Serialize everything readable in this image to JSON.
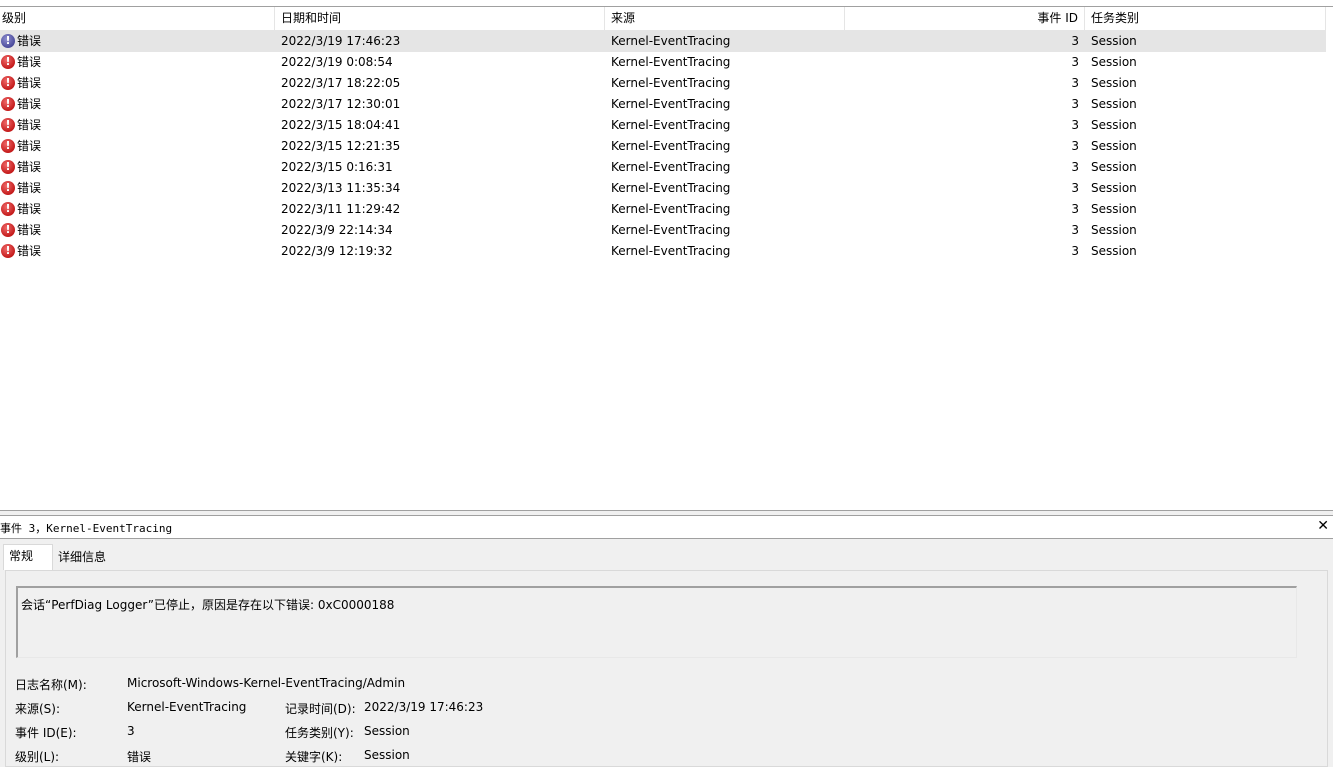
{
  "columns": {
    "level": "级别",
    "datetime": "日期和时间",
    "source": "来源",
    "event_id": "事件 ID",
    "task": "任务类别"
  },
  "events": [
    {
      "level": "错误",
      "datetime": "2022/3/19 17:46:23",
      "source": "Kernel-EventTracing",
      "event_id": "3",
      "task": "Session"
    },
    {
      "level": "错误",
      "datetime": "2022/3/19 0:08:54",
      "source": "Kernel-EventTracing",
      "event_id": "3",
      "task": "Session"
    },
    {
      "level": "错误",
      "datetime": "2022/3/17 18:22:05",
      "source": "Kernel-EventTracing",
      "event_id": "3",
      "task": "Session"
    },
    {
      "level": "错误",
      "datetime": "2022/3/17 12:30:01",
      "source": "Kernel-EventTracing",
      "event_id": "3",
      "task": "Session"
    },
    {
      "level": "错误",
      "datetime": "2022/3/15 18:04:41",
      "source": "Kernel-EventTracing",
      "event_id": "3",
      "task": "Session"
    },
    {
      "level": "错误",
      "datetime": "2022/3/15 12:21:35",
      "source": "Kernel-EventTracing",
      "event_id": "3",
      "task": "Session"
    },
    {
      "level": "错误",
      "datetime": "2022/3/15 0:16:31",
      "source": "Kernel-EventTracing",
      "event_id": "3",
      "task": "Session"
    },
    {
      "level": "错误",
      "datetime": "2022/3/13 11:35:34",
      "source": "Kernel-EventTracing",
      "event_id": "3",
      "task": "Session"
    },
    {
      "level": "错误",
      "datetime": "2022/3/11 11:29:42",
      "source": "Kernel-EventTracing",
      "event_id": "3",
      "task": "Session"
    },
    {
      "level": "错误",
      "datetime": "2022/3/9 22:14:34",
      "source": "Kernel-EventTracing",
      "event_id": "3",
      "task": "Session"
    },
    {
      "level": "错误",
      "datetime": "2022/3/9 12:19:32",
      "source": "Kernel-EventTracing",
      "event_id": "3",
      "task": "Session"
    }
  ],
  "detail": {
    "title": "事件 3，Kernel-EventTracing",
    "close_glyph": "✕",
    "tabs": [
      "常规",
      "详细信息"
    ],
    "message": "会话“PerfDiag Logger”已停止，原因是存在以下错误: 0xC0000188",
    "log_name_label": "日志名称(M):",
    "log_name_value": "Microsoft-Windows-Kernel-EventTracing/Admin",
    "source_label": "来源(S):",
    "source_value": "Kernel-EventTracing",
    "logged_label": "记录时间(D):",
    "logged_value": "2022/3/19 17:46:23",
    "event_id_label": "事件 ID(E):",
    "event_id_value": "3",
    "task_label": "任务类别(Y):",
    "task_value": "Session",
    "level_label": "级别(L):",
    "level_value": "错误",
    "keywords_label": "关键字(K):",
    "keywords_value": "Session"
  },
  "icons": {
    "error": "error-icon",
    "close": "close-icon"
  },
  "colors": {
    "selected_row": "#e5e5e5",
    "error_red": "#c41b1b",
    "pane_bg": "#f0f0f0"
  }
}
